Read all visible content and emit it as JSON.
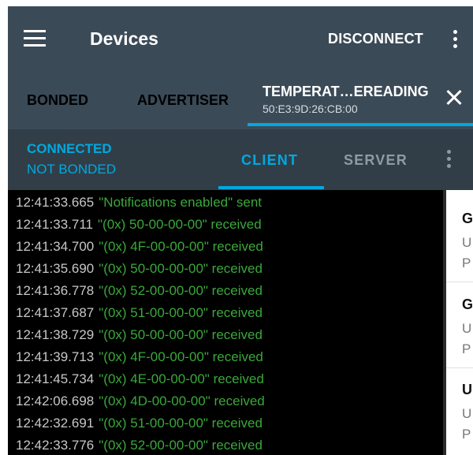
{
  "appbar": {
    "title": "Devices",
    "disconnect_label": "DISCONNECT"
  },
  "device_tabs": {
    "items": [
      "BONDED",
      "ADVERTISER"
    ],
    "active_name": "TEMPERAT…EREADING",
    "active_address": "50:E3:9D:26:CB:00"
  },
  "connection": {
    "state": "CONNECTED",
    "bond": "NOT BONDED",
    "modes": [
      "CLIENT",
      "SERVER"
    ],
    "active_mode": "CLIENT"
  },
  "log": [
    {
      "time": "12:41:33.665",
      "msg": "\"Notifications enabled\" sent"
    },
    {
      "time": "12:41:33.711",
      "msg": "\"(0x) 50-00-00-00\" received"
    },
    {
      "time": "12:41:34.700",
      "msg": "\"(0x) 4F-00-00-00\" received"
    },
    {
      "time": "12:41:35.690",
      "msg": "\"(0x) 50-00-00-00\" received"
    },
    {
      "time": "12:41:36.778",
      "msg": "\"(0x) 52-00-00-00\" received"
    },
    {
      "time": "12:41:37.687",
      "msg": "\"(0x) 51-00-00-00\" received"
    },
    {
      "time": "12:41:38.729",
      "msg": "\"(0x) 50-00-00-00\" received"
    },
    {
      "time": "12:41:39.713",
      "msg": "\"(0x) 4F-00-00-00\" received"
    },
    {
      "time": "12:41:45.734",
      "msg": "\"(0x) 4E-00-00-00\" received"
    },
    {
      "time": "12:42:06.698",
      "msg": "\"(0x) 4D-00-00-00\" received"
    },
    {
      "time": "12:42:32.691",
      "msg": "\"(0x) 51-00-00-00\" received"
    },
    {
      "time": "12:42:33.776",
      "msg": "\"(0x) 52-00-00-00\" received"
    }
  ],
  "services": [
    {
      "name": "G",
      "line1": "U",
      "line2": "P"
    },
    {
      "name": "G",
      "line1": "U",
      "line2": "P"
    },
    {
      "name": "U",
      "line1": "U",
      "line2": "P"
    }
  ],
  "colors": {
    "accent": "#00a9e0",
    "appbar": "#3b4a57",
    "log_message": "#3aa83a"
  }
}
